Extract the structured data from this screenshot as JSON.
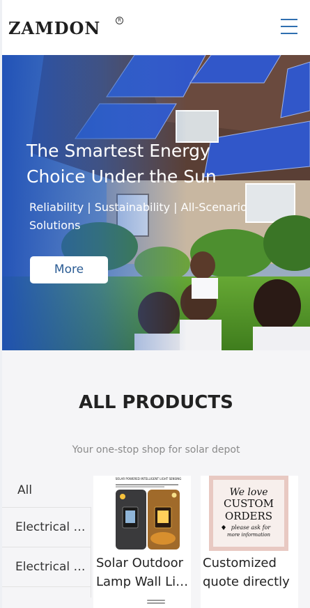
{
  "header": {
    "logo": "ZAMDON",
    "logo_mark": "R",
    "menu_icon": "hamburger-menu-icon",
    "accent_color": "#2f6fb0"
  },
  "hero": {
    "title_line1": "The Smartest Energy",
    "title_line2": "Choice Under the Sun",
    "subtitle": "Reliability | Sustainability | All-Scenario Solutions",
    "more_label": "More"
  },
  "products": {
    "title": "ALL PRODUCTS",
    "subtitle": "Your one-stop shop for solar depot",
    "categories": [
      {
        "label": "All"
      },
      {
        "label": "Electrical Equipment"
      },
      {
        "label": "Electrical Equipment"
      },
      {
        "label": ""
      }
    ],
    "items": [
      {
        "name_line1": "Solar Outdoor",
        "name_line2": "Lamp Wall Light",
        "image_caption": "SOLAR POWERED INTELLIGENT LIGHT SENSING"
      },
      {
        "name_line1": "Customized",
        "name_line2": "quote directly",
        "image_text": [
          "We love",
          "CUSTOM",
          "ORDERS",
          "please ask for",
          "more information"
        ]
      }
    ]
  }
}
